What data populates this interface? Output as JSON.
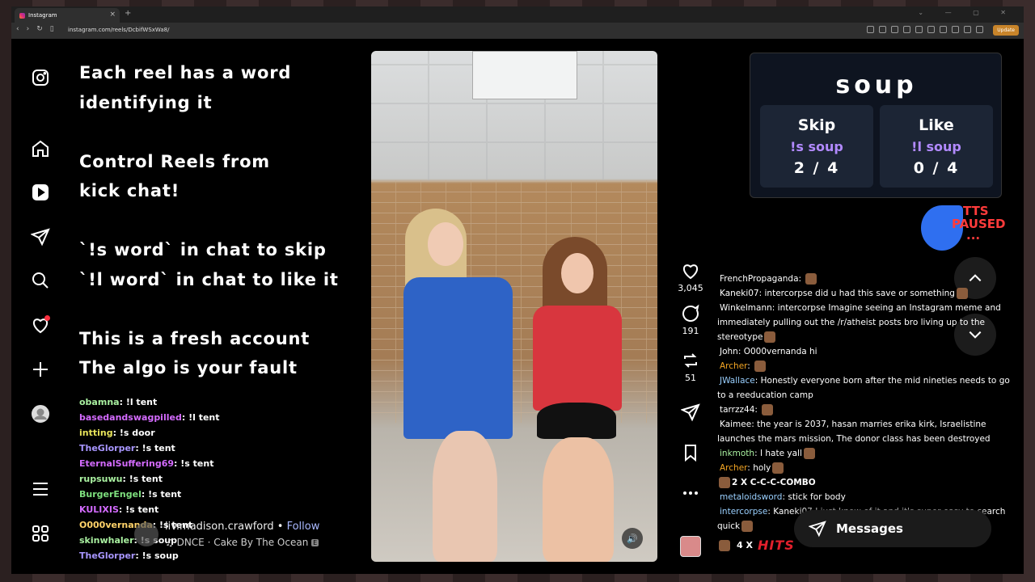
{
  "browser": {
    "tab_title": "Instagram",
    "tab_close": "×",
    "new_tab": "+",
    "window_controls": "⌄ — ▢ ✕",
    "url": "instagram.com/reels/DcbifWSxWa8/",
    "update_label": "Update"
  },
  "overlay": {
    "lines": [
      "Each reel has a word",
      "identifying it",
      "",
      "Control Reels from",
      "kick chat!",
      "",
      "`!s word` in chat to skip",
      "`!l word` in chat to like it",
      "",
      "This is a fresh account",
      "The algo is your fault"
    ]
  },
  "left_chat": [
    {
      "user": "obamna",
      "text": "!l tent",
      "color": "#a9f0a0"
    },
    {
      "user": "basedandswagpilled",
      "text": "!l tent",
      "color": "#d46bff"
    },
    {
      "user": "intting",
      "text": "!s door",
      "color": "#e7e35a"
    },
    {
      "user": "TheGlorper",
      "text": "!s tent",
      "color": "#a896ff"
    },
    {
      "user": "EternalSuffering69",
      "text": "!s tent",
      "color": "#d46bff"
    },
    {
      "user": "rupsuwu",
      "text": "!s tent",
      "color": "#a9f0a0"
    },
    {
      "user": "BurgerEngel",
      "text": "!s tent",
      "color": "#7ee07e"
    },
    {
      "user": "KULIXIS",
      "text": "!s tent",
      "color": "#d46bff"
    },
    {
      "user": "O000vernanda",
      "text": "!s tent",
      "color": "#ffd36a"
    },
    {
      "user": "skinwhaler",
      "text": "!s soup",
      "color": "#a9f0a0"
    },
    {
      "user": "TheGlorper",
      "text": "!s soup",
      "color": "#a896ff"
    }
  ],
  "reel": {
    "username": "liv.madison.crawford",
    "separator": " • ",
    "follow": "Follow",
    "song": "♫ DNCE · Cake By The Ocean",
    "explicit": "E",
    "volume_icon": "🔊"
  },
  "actions": {
    "likes": "3,045",
    "comments": "191",
    "reposts": "51"
  },
  "soup": {
    "word": "soup",
    "skip_label": "Skip",
    "skip_cmd": "!s soup",
    "skip_count": "2 / 4",
    "like_label": "Like",
    "like_cmd": "!l soup",
    "like_count": "0 / 4"
  },
  "tts": {
    "line1": "TTS",
    "line2": "PAUSED",
    "line3": "..."
  },
  "right_chat": [
    {
      "user": "FrenchPropaganda",
      "text": "",
      "color": "#ffffff",
      "emote": true
    },
    {
      "user": "Kaneki07",
      "text": "intercorpse did u had this save or something",
      "color": "#ffffff",
      "emote": true
    },
    {
      "user": "Winkelmann",
      "text": "intercorpse  Imagine seeing an Instagram meme and immediately pulling out the /r/atheist posts bro living up to the stereotype",
      "color": "#ffffff",
      "emote": true
    },
    {
      "user": "John",
      "text": "O000vernanda hi",
      "color": "#ffffff",
      "emote": false
    },
    {
      "user": "Archer",
      "text": "",
      "color": "#f5a623",
      "emote": true
    },
    {
      "user": "JWallace",
      "text": "Honestly everyone born after the mid nineties needs to go to a reeducation camp",
      "color": "#9ad0ff",
      "emote": false
    },
    {
      "user": "tarrzz44",
      "text": "",
      "color": "#ffffff",
      "emote": true
    },
    {
      "user": "Kaimee",
      "text": "the year is 2037, hasan marries erika kirk, Israelistine launches the mars mission, The donor class has been destroyed",
      "color": "#ffffff",
      "emote": false
    },
    {
      "user": "inkmoth",
      "text": "I hate yall",
      "color": "#a9f0a0",
      "emote": true
    },
    {
      "user": "Archer",
      "text": "holy",
      "color": "#f5a623",
      "emote": true
    },
    {
      "user": "",
      "text": "2 X C-C-C-COMBO",
      "color": "#ffffff",
      "emote": true,
      "combo": true
    },
    {
      "user": "metaloidsword",
      "text": "stick for body",
      "color": "#9ad0ff",
      "emote": false
    },
    {
      "user": "intercorpse",
      "text": "Kaneki07 I just know of it and it's super easy to search quick",
      "color": "#9ad0ff",
      "emote": true
    }
  ],
  "hits": {
    "count": "4 X",
    "label": "HITS"
  },
  "messages_label": "Messages"
}
